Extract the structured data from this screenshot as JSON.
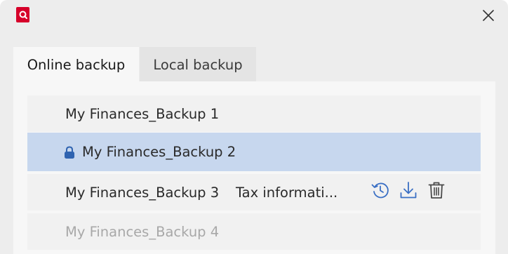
{
  "window": {
    "close_label": "Close"
  },
  "tabs": [
    {
      "label": "Online backup",
      "active": true
    },
    {
      "label": "Local backup",
      "active": false
    }
  ],
  "backups": [
    {
      "name": "My Finances_Backup 1",
      "description": ""
    },
    {
      "name": "My Finances_Backup 2",
      "description": "",
      "selected": true,
      "locked": true
    },
    {
      "name": "My Finances_Backup 3",
      "description": "Tax informati...",
      "actions": [
        "restore-icon",
        "download-icon",
        "trash-icon"
      ]
    },
    {
      "name": "My Finances_Backup 4",
      "description": "",
      "disabled": true
    }
  ],
  "colors": {
    "brand": "#d6002a",
    "selected_row": "#c7d7ee",
    "lock": "#2f63b0",
    "action_icon": "#3a6fc4"
  }
}
